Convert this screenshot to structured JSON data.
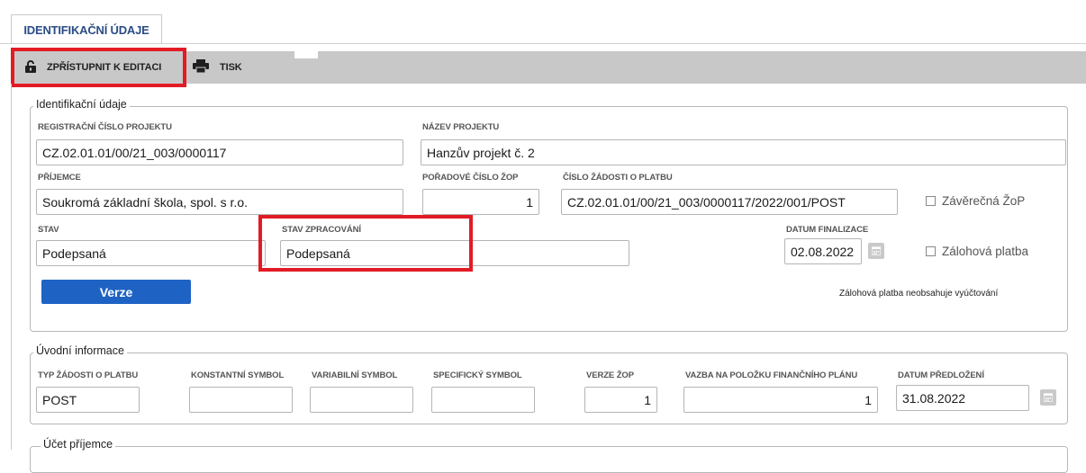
{
  "tab": {
    "label": "IDENTIFIKAČNÍ ÚDAJE"
  },
  "toolbar": {
    "unlock_label": "ZPŘÍSTUPNIT K EDITACI",
    "print_label": "TISK"
  },
  "identification": {
    "legend": "Identifikační údaje",
    "reg_number": {
      "label": "REGISTRAČNÍ ČÍSLO PROJEKTU",
      "value": "CZ.02.01.01/00/21_003/0000117"
    },
    "project_name": {
      "label": "NÁZEV PROJEKTU",
      "value": "Hanzův projekt č. 2"
    },
    "recipient": {
      "label": "PŘÍJEMCE",
      "value": "Soukromá základní škola, spol. s r.o."
    },
    "order_number": {
      "label": "POŘADOVÉ ČÍSLO ŽOP",
      "value": "1"
    },
    "request_number": {
      "label": "ČÍSLO ŽÁDOSTI O PLATBU",
      "value": "CZ.02.01.01/00/21_003/0000117/2022/001/POST"
    },
    "final_zop": {
      "label": "Závěrečná ŽoP"
    },
    "state": {
      "label": "STAV",
      "value": "Podepsaná"
    },
    "processing_state": {
      "label": "STAV ZPRACOVÁNÍ",
      "value": "Podepsaná"
    },
    "finalization_date": {
      "label": "DATUM FINALIZACE",
      "value": "02.08.2022"
    },
    "advance_payment": {
      "label": "Zálohová platba"
    },
    "version_button": "Verze",
    "advance_note": "Zálohová platba neobsahuje vyúčtování"
  },
  "intro": {
    "legend": "Úvodní informace",
    "request_type": {
      "label": "TYP ŽÁDOSTI O PLATBU",
      "value": "POST"
    },
    "constant_symbol": {
      "label": "KONSTANTNÍ SYMBOL",
      "value": ""
    },
    "variable_symbol": {
      "label": "VARIABILNÍ SYMBOL",
      "value": ""
    },
    "specific_symbol": {
      "label": "SPECIFICKÝ SYMBOL",
      "value": ""
    },
    "zop_version": {
      "label": "VERZE ŽOP",
      "value": "1"
    },
    "plan_link": {
      "label": "VAZBA NA POLOŽKU FINANČNÍHO PLÁNU",
      "value": "1"
    },
    "submission_date": {
      "label": "DATUM PŘEDLOŽENÍ",
      "value": "31.08.2022"
    }
  },
  "account": {
    "legend": "Účet příjemce"
  },
  "colors": {
    "accent_blue": "#1e63c4",
    "highlight_red": "#e21b24",
    "toolbar_gray": "#c8c8c8",
    "tab_text": "#2a4d86"
  }
}
